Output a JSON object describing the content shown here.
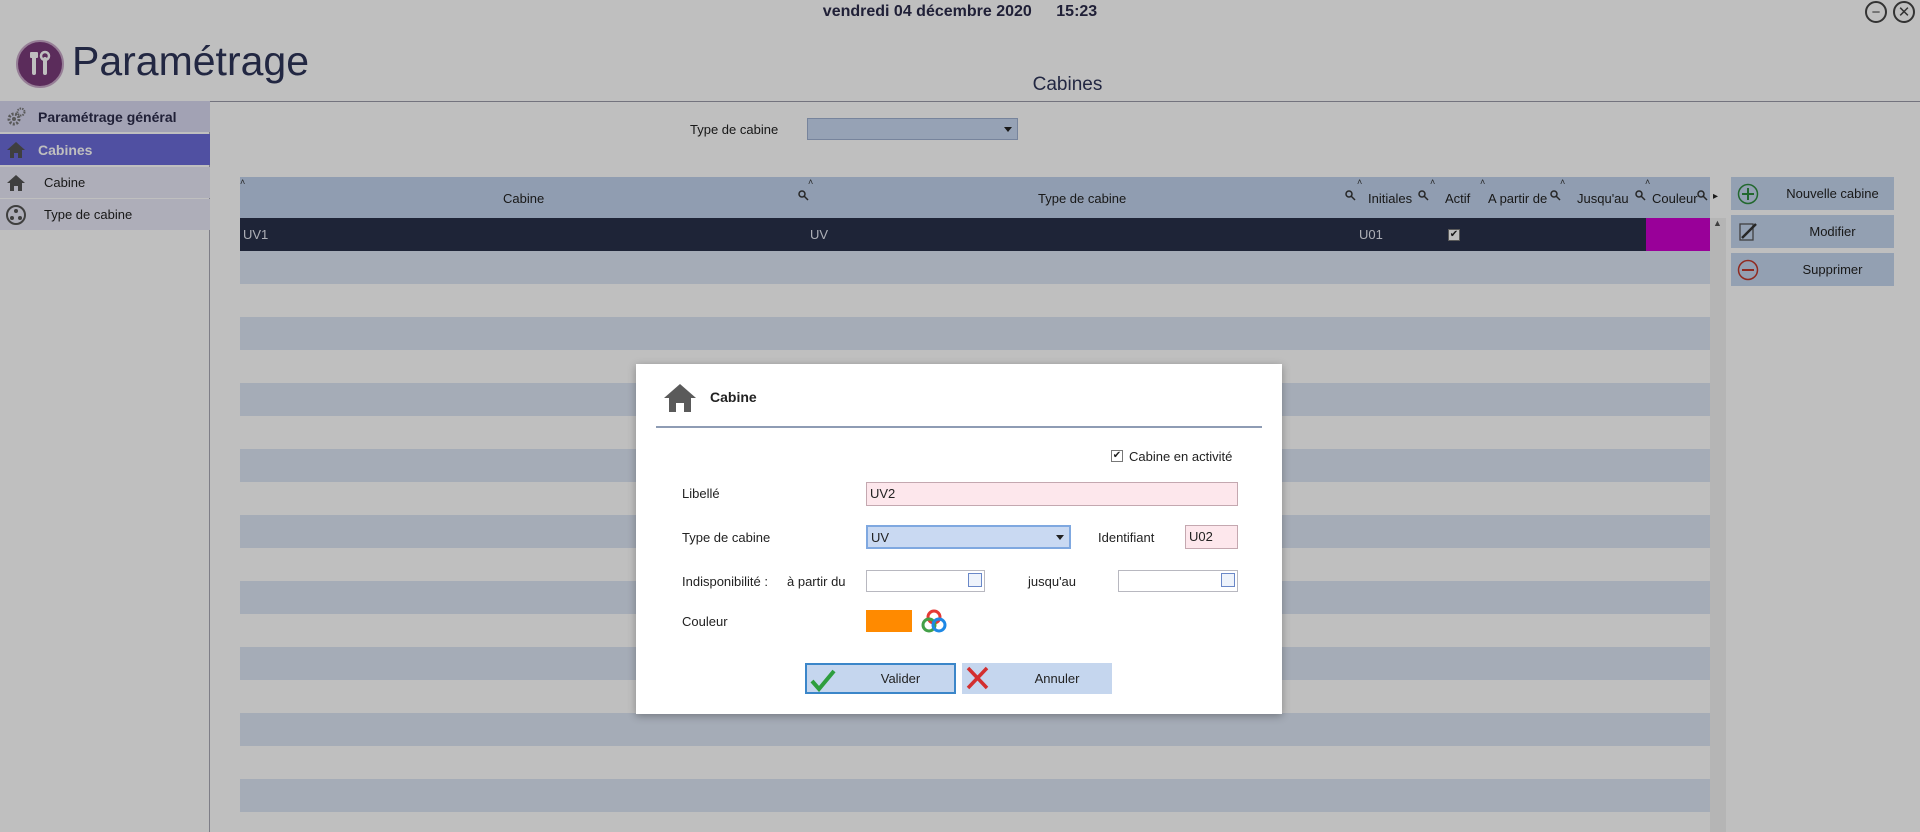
{
  "header": {
    "date": "vendredi 04 décembre 2020",
    "time": "15:23",
    "app_title": "Paramétrage",
    "section_title": "Cabines"
  },
  "sidebar": {
    "general": "Paramétrage général",
    "cabines": "Cabines",
    "items": [
      {
        "label": "Cabine",
        "icon": "house-icon"
      },
      {
        "label": "Type de cabine",
        "icon": "type-circle-icon"
      }
    ]
  },
  "filter": {
    "label": "Type de cabine",
    "value": ""
  },
  "table": {
    "columns": [
      "Cabine",
      "Type de cabine",
      "Initiales",
      "Actif",
      "A partir de",
      "Jusqu'au",
      "Couleur"
    ],
    "rows": [
      {
        "cabine": "UV1",
        "type": "UV",
        "initiales": "U01",
        "actif": "✔",
        "a_partir_de": "",
        "jusquau": "",
        "couleur": "#cc00cc"
      }
    ]
  },
  "actions": {
    "new": "Nouvelle cabine",
    "edit": "Modifier",
    "delete": "Supprimer"
  },
  "dialog": {
    "title": "Cabine",
    "active_label": "Cabine en activité",
    "active_checked": "✔",
    "libelle_label": "Libellé",
    "libelle_value": "UV2",
    "type_label": "Type de cabine",
    "type_value": "UV",
    "identifiant_label": "Identifiant",
    "identifiant_value": "U02",
    "indispo_label": "Indisponibilité :",
    "from_label": "à partir du",
    "to_label": "jusqu'au",
    "from_value": "",
    "to_value": "",
    "couleur_label": "Couleur",
    "couleur_value": "#ff8a00",
    "validate": "Valider",
    "cancel": "Annuler"
  },
  "colors": {
    "accent": "#6b6bd8",
    "selected_row": "#28304a",
    "header_bg": "#c0d2ec"
  }
}
